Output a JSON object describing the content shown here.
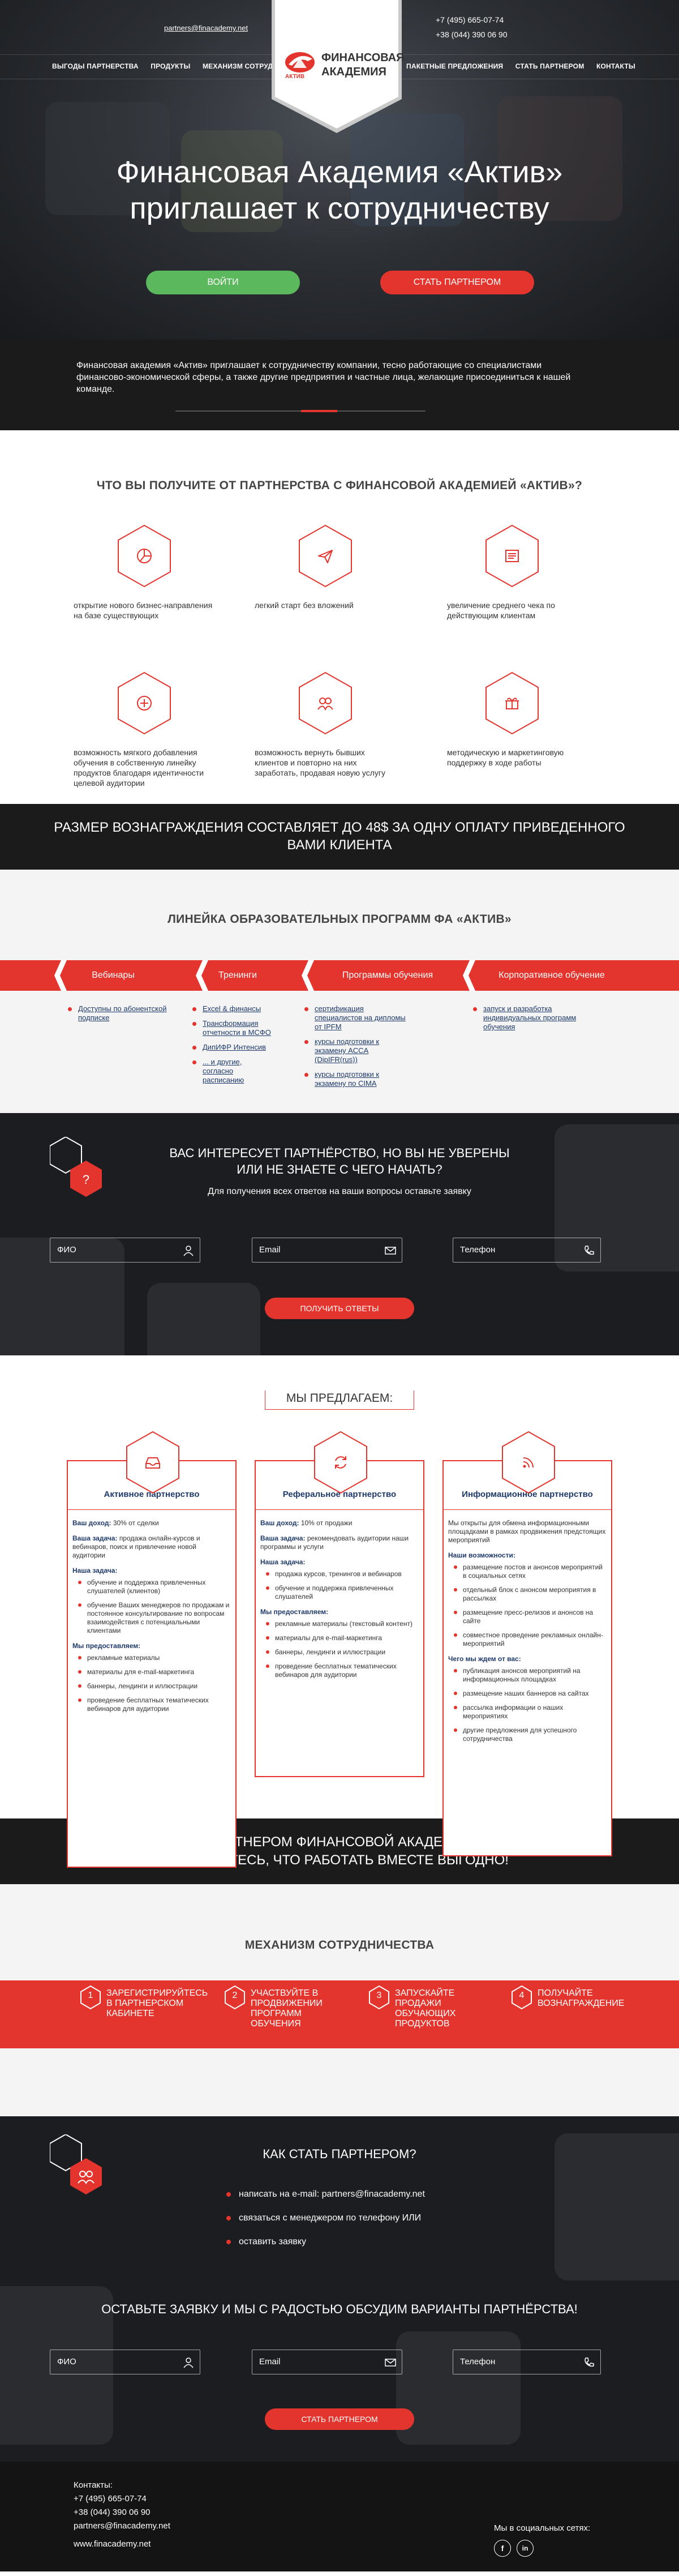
{
  "header": {
    "email": "partners@finacademy.net",
    "phone1": "+7 (495) 665-07-74",
    "phone2": "+38 (044) 390 06 90",
    "nav_left": [
      "ВЫГОДЫ ПАРТНЕРСТВА",
      "ПРОДУКТЫ",
      "МЕХАНИЗМ СОТРУДНИЧЕСТВА"
    ],
    "nav_right": [
      "ПАКЕТНЫЕ ПРЕДЛОЖЕНИЯ",
      "СТАТЬ ПАРТНЕРОМ",
      "КОНТАКТЫ"
    ],
    "logo_line1": "ФИНАНСОВАЯ",
    "logo_line2": "АКАДЕМИЯ",
    "logo_sub": "АКТИВ"
  },
  "hero": {
    "title_line1": "Финансовая Академия «Актив»",
    "title_line2": "приглашает к сотрудничеству",
    "login_label": "ВОЙТИ",
    "partner_label": "СТАТЬ ПАРТНЕРОМ"
  },
  "intro": {
    "text": "Финансовая академия «Актив» приглашает к сотрудничеству компании, тесно работающие со специалистами финансово-экономической сферы, а также другие предприятия и частные лица, желающие присоединиться к нашей команде."
  },
  "benefits": {
    "title": "ЧТО ВЫ ПОЛУЧИТЕ ОТ ПАРТНЕРСТВА С ФИНАНСОВОЙ АКАДЕМИЕЙ «АКТИВ»?",
    "items": [
      {
        "icon": "pie-chart-icon",
        "text": "открытие нового бизнес-направления на базе существующих"
      },
      {
        "icon": "paper-plane-icon",
        "text": "легкий старт без вложений"
      },
      {
        "icon": "document-icon",
        "text": "увеличение среднего чека по действующим клиентам"
      },
      {
        "icon": "plus-icon",
        "text": "возможность мягкого добавления обучения в собственную линейку продуктов благодаря идентичности целевой аудитории"
      },
      {
        "icon": "users-icon",
        "text": "возможность вернуть бывших клиентов и повторно на них заработать, продавая новую услугу"
      },
      {
        "icon": "gift-icon",
        "text": "методическую и маркетинговую поддержку в ходе работы"
      }
    ]
  },
  "reward": {
    "line1_a": "РАЗМЕР ВОЗНАГРАЖДЕНИЯ СОСТАВЛЯЕТ ДО ",
    "amount": "48$",
    "line1_b": " ЗА ОДНУ ОПЛАТУ ПРИВЕДЕННОГО",
    "line2": "ВАМИ КЛИЕНТА"
  },
  "programs": {
    "title": "ЛИНЕЙКА ОБРАЗОВАТЕЛЬНЫХ ПРОГРАММ ФА «АКТИВ»",
    "tabs": [
      "Вебинары",
      "Тренинги",
      "Программы обучения",
      "Корпоративное обучение"
    ],
    "col1": [
      "Доступны по абонентской подписке"
    ],
    "col2": [
      "Excel & финансы",
      "Трансформация отчетности в МСФО",
      "ДипИФР Интенсив",
      "... и другие, согласно расписанию"
    ],
    "col3": [
      "сертификация специалистов на дипломы от IPFM",
      "курсы подготовки к экзамену ACCA (DipIFR(rus))",
      "курсы подготовки к экзамену по CIMA"
    ],
    "col4": [
      "запуск и разработка индивидуальных программ обучения"
    ]
  },
  "interest": {
    "title_line1": "ВАС ИНТЕРЕСУЕТ ПАРТНЁРСТВО, НО ВЫ НЕ УВЕРЕНЫ",
    "title_line2": "ИЛИ НЕ ЗНАЕТЕ С ЧЕГО НАЧАТЬ?",
    "subtitle": "Для получения всех ответов на ваши вопросы оставьте заявку",
    "name_placeholder": "ФИО",
    "email_placeholder": "Email",
    "phone_placeholder": "Телефон",
    "submit_label": "ПОЛУЧИТЬ ОТВЕТЫ"
  },
  "offers": {
    "title": "МЫ ПРЕДЛАГАЕМ:",
    "cards": [
      {
        "icon": "inbox-icon",
        "title": "Активное партнерство",
        "income_label": "Ваш доход:",
        "income": "30% от сделки",
        "task_label": "Ваша задача:",
        "task": "продажа онлайн-курсов и вебинаров, поиск и привлечение новой аудитории",
        "our_tasks_label": "Наша задача:",
        "our_tasks": [
          "обучение и поддержка привлеченных слушателей (клиентов)",
          "обучение Ваших менеджеров по продажам и постоянное консультирование по вопросам взаимодействия с потенциальными клиентами"
        ],
        "provide_label": "Мы предоставляем:",
        "provide": [
          "рекламные материалы",
          "материалы для e-mail-маркетинга",
          "баннеры, лендинги и иллюстрации",
          "проведение бесплатных тематических вебинаров для аудитории"
        ]
      },
      {
        "icon": "refresh-icon",
        "title": "Реферальное партнерство",
        "income_label": "Ваш доход:",
        "income": "10% от продажи",
        "task_label": "Ваша задача:",
        "task": "рекомендовать аудитории наши программы и услуги",
        "our_tasks_label": "Наша задача:",
        "our_tasks": [
          "продажа курсов, тренингов и вебинаров",
          "обучение и поддержка привлеченных слушателей"
        ],
        "provide_label": "Мы предоставляем:",
        "provide": [
          "рекламные материалы (текстовый контент)",
          "материалы для e-mail-маркетинга",
          "баннеры, лендинги и иллюстрации",
          "проведение бесплатных тематических вебинаров для аудитории"
        ]
      },
      {
        "icon": "rss-icon",
        "title": "Информационное партнерство",
        "intro": "Мы открыты для обмена информационными площадками в рамках продвижения предстоящих мероприятий",
        "our_tasks_label": "Наши возможности:",
        "our_tasks": [
          "размещение постов и анонсов мероприятий в социальных сетях",
          "отдельный блок с анонсом мероприятия в рассылках",
          "размещение пресс-релизов и анонсов на сайте",
          "совместное проведение рекламных онлайн-мероприятий"
        ],
        "provide_label": "Чего мы ждем от вас:",
        "provide": [
          "публикация анонсов мероприятий на информационных площадках",
          "размещение наших баннеров на сайтах",
          "рассылка информации о наших мероприятиях",
          "другие предложения для успешного сотрудничества"
        ]
      }
    ]
  },
  "cta": {
    "line1": "СТАНЬТЕ ПАРТНЕРОМ ФИНАНСОВОЙ АКАДЕМИИ «АКТИВ»",
    "line2": "И УБЕДИТЕСЬ, ЧТО РАБОТАТЬ ВМЕСТЕ ВЫГОДНО!"
  },
  "mechanism": {
    "title": "МЕХАНИЗМ СОТРУДНИЧЕСТВА",
    "steps": [
      {
        "num": "1",
        "text": "ЗАРЕГИСТРИРУЙТЕСЬ В ПАРТНЕРСКОМ КАБИНЕТЕ"
      },
      {
        "num": "2",
        "text": "УЧАСТВУЙТЕ В ПРОДВИЖЕНИИ ПРОГРАММ ОБУЧЕНИЯ"
      },
      {
        "num": "3",
        "text": "ЗАПУСКАЙТЕ ПРОДАЖИ ОБУЧАЮЩИХ ПРОДУКТОВ"
      },
      {
        "num": "4",
        "text": "ПОЛУЧАЙТЕ ВОЗНАГРАЖДЕНИЕ"
      }
    ]
  },
  "how": {
    "title": "КАК СТАТЬ ПАРТНЕРОМ?",
    "items": [
      "написать на e-mail: partners@finacademy.net",
      "связаться с менеджером по телефону ИЛИ",
      "оставить заявку"
    ],
    "title2": "ОСТАВЬТЕ ЗАЯВКУ И МЫ С РАДОСТЬЮ ОБСУДИМ ВАРИАНТЫ ПАРТНЁРСТВА!",
    "name_placeholder": "ФИО",
    "email_placeholder": "Email",
    "phone_placeholder": "Телефон",
    "submit_label": "СТАТЬ ПАРТНЕРОМ"
  },
  "footer": {
    "contacts_label": "Контакты:",
    "phone1": "+7 (495) 665-07-74",
    "phone2": "+38 (044) 390 06 90",
    "email": "partners@finacademy.net",
    "site": "www.finacademy.net",
    "social_label": "Мы в социальных сетях:",
    "social": [
      "f",
      "in"
    ]
  },
  "colors": {
    "accent": "#e3352d",
    "dark": "#1b1b1b",
    "navy": "#1e3a6b",
    "green": "#5cb85c"
  }
}
